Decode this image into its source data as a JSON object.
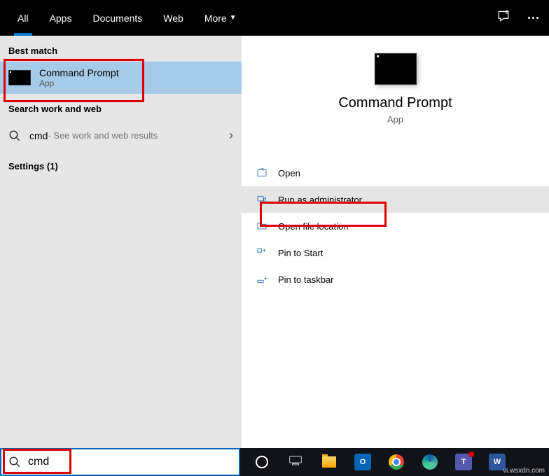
{
  "topbar": {
    "tabs": {
      "all": "All",
      "apps": "Apps",
      "documents": "Documents",
      "web": "Web",
      "more": "More"
    }
  },
  "left": {
    "best_match_header": "Best match",
    "app_title": "Command Prompt",
    "app_sub": "App",
    "search_header": "Search work and web",
    "search_term": "cmd",
    "search_hint": " - See work and web results",
    "settings_header": "Settings (1)"
  },
  "right": {
    "title": "Command Prompt",
    "sub": "App",
    "actions": {
      "open": "Open",
      "run_admin": "Run as administrator",
      "file_loc": "Open file location",
      "pin_start": "Pin to Start",
      "pin_taskbar": "Pin to taskbar"
    }
  },
  "taskbar": {
    "search_value": "cmd"
  },
  "watermark": "vi.wsxdn.com"
}
